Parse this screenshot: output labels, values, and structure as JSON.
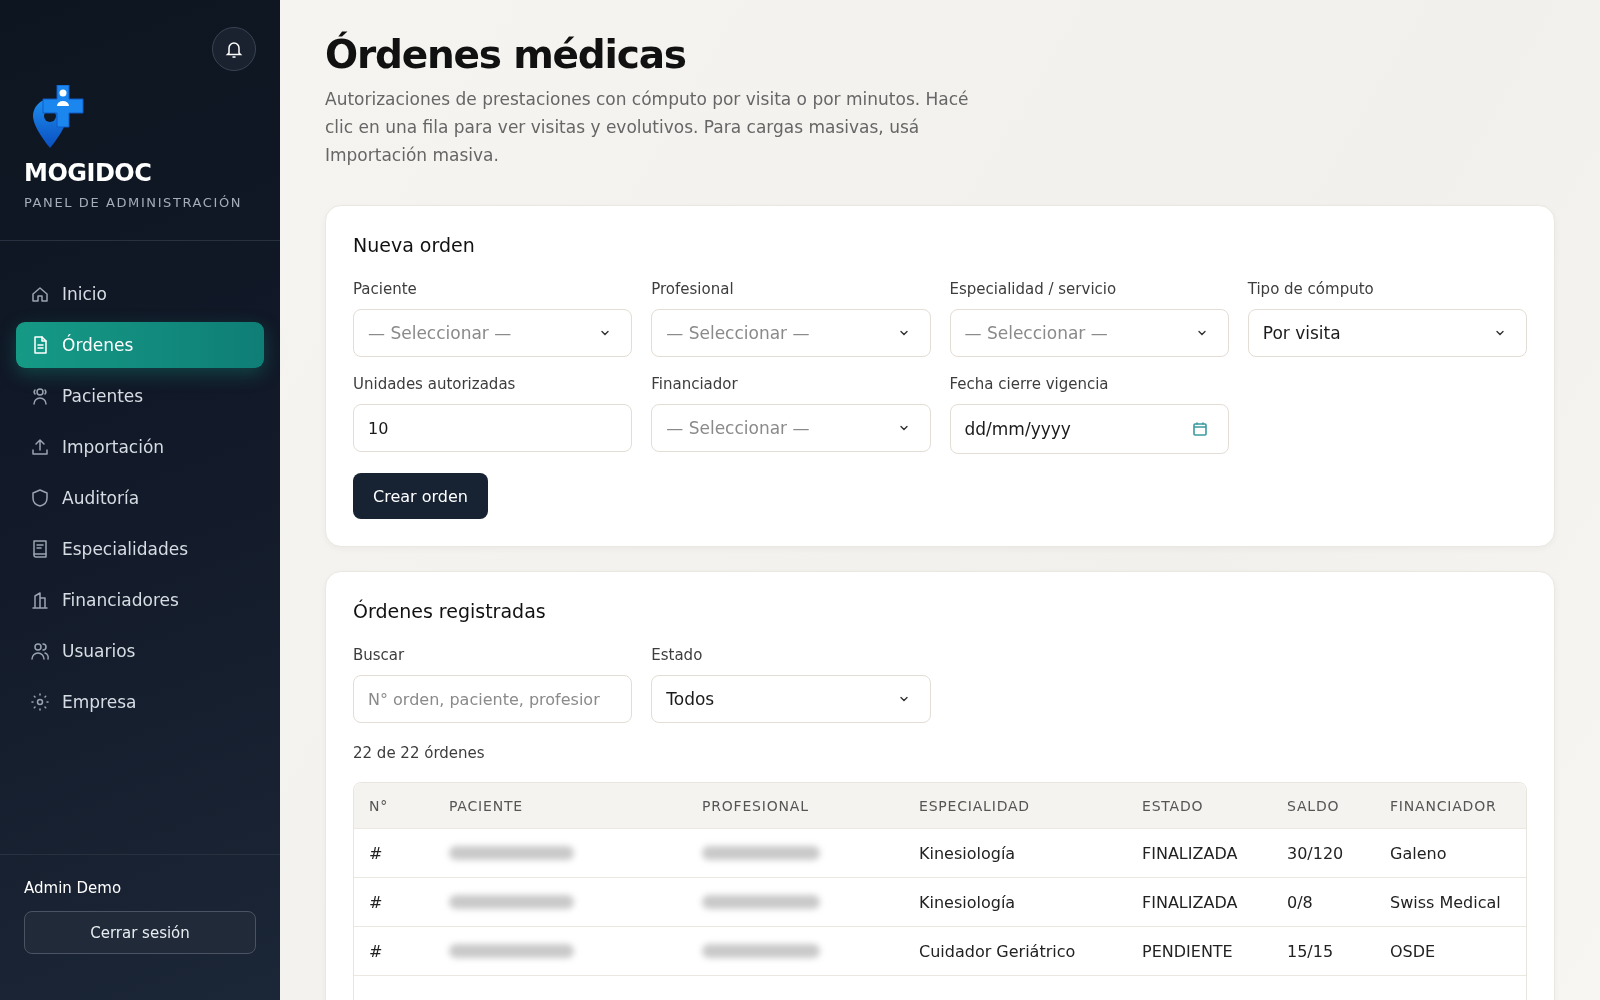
{
  "sidebar": {
    "brand": "MOGIDOC",
    "subtitle": "PANEL DE ADMINISTRACIÓN",
    "items": [
      {
        "label": "Inicio",
        "selected": false
      },
      {
        "label": "Órdenes",
        "selected": true
      },
      {
        "label": "Pacientes",
        "selected": false
      },
      {
        "label": "Importación",
        "selected": false
      },
      {
        "label": "Auditoría",
        "selected": false
      },
      {
        "label": "Especialidades",
        "selected": false
      },
      {
        "label": "Financiadores",
        "selected": false
      },
      {
        "label": "Usuarios",
        "selected": false
      },
      {
        "label": "Empresa",
        "selected": false
      }
    ],
    "user": "Admin Demo",
    "logout": "Cerrar sesión"
  },
  "header": {
    "title": "Órdenes médicas",
    "description": "Autorizaciones de prestaciones con cómputo por visita o por minutos. Hacé clic en una fila para ver visitas y evolutivos. Para cargas masivas, usá Importación masiva."
  },
  "new_order": {
    "title": "Nueva orden",
    "fields": [
      {
        "label": "Paciente",
        "kind": "select",
        "placeholder": "— Seleccionar —"
      },
      {
        "label": "Profesional",
        "kind": "select",
        "placeholder": "— Seleccionar —"
      },
      {
        "label": "Especialidad / servicio",
        "kind": "select",
        "placeholder": "— Seleccionar —"
      },
      {
        "label": "Tipo de cómputo",
        "kind": "select",
        "value": "Por visita"
      },
      {
        "label": "Unidades autorizadas",
        "kind": "input",
        "value": "10"
      },
      {
        "label": "Financiador",
        "kind": "select",
        "placeholder": "— Seleccionar —"
      },
      {
        "label": "Fecha cierre vigencia",
        "kind": "date",
        "value": "dd/mm/yyyy"
      }
    ],
    "submit": "Crear orden"
  },
  "orders": {
    "title": "Órdenes registradas",
    "filters": [
      {
        "label": "Buscar",
        "kind": "input",
        "placeholder": "N° orden, paciente, profesior"
      },
      {
        "label": "Estado",
        "kind": "select",
        "value": "Todos"
      }
    ],
    "count": "22 de 22 órdenes",
    "table": {
      "columns": [
        "N°",
        "PACIENTE",
        "PROFESIONAL",
        "ESPECIALIDAD",
        "ESTADO",
        "SALDO",
        "FINANCIADOR"
      ],
      "rows": [
        {
          "number": "#",
          "patient_blurred": true,
          "professional_blurred": true,
          "specialty": "Kinesiología",
          "status": "FINALIZADA",
          "balance": "30/120",
          "payer": "Galeno"
        },
        {
          "number": "#",
          "patient_blurred": true,
          "professional_blurred": true,
          "specialty": "Kinesiología",
          "status": "FINALIZADA",
          "balance": "0/8",
          "payer": "Swiss Medical"
        },
        {
          "number": "#",
          "patient_blurred": true,
          "professional_blurred": true,
          "specialty": "Cuidador Geriátrico",
          "status": "PENDIENTE",
          "balance": "15/15",
          "payer": "OSDE"
        }
      ]
    }
  }
}
